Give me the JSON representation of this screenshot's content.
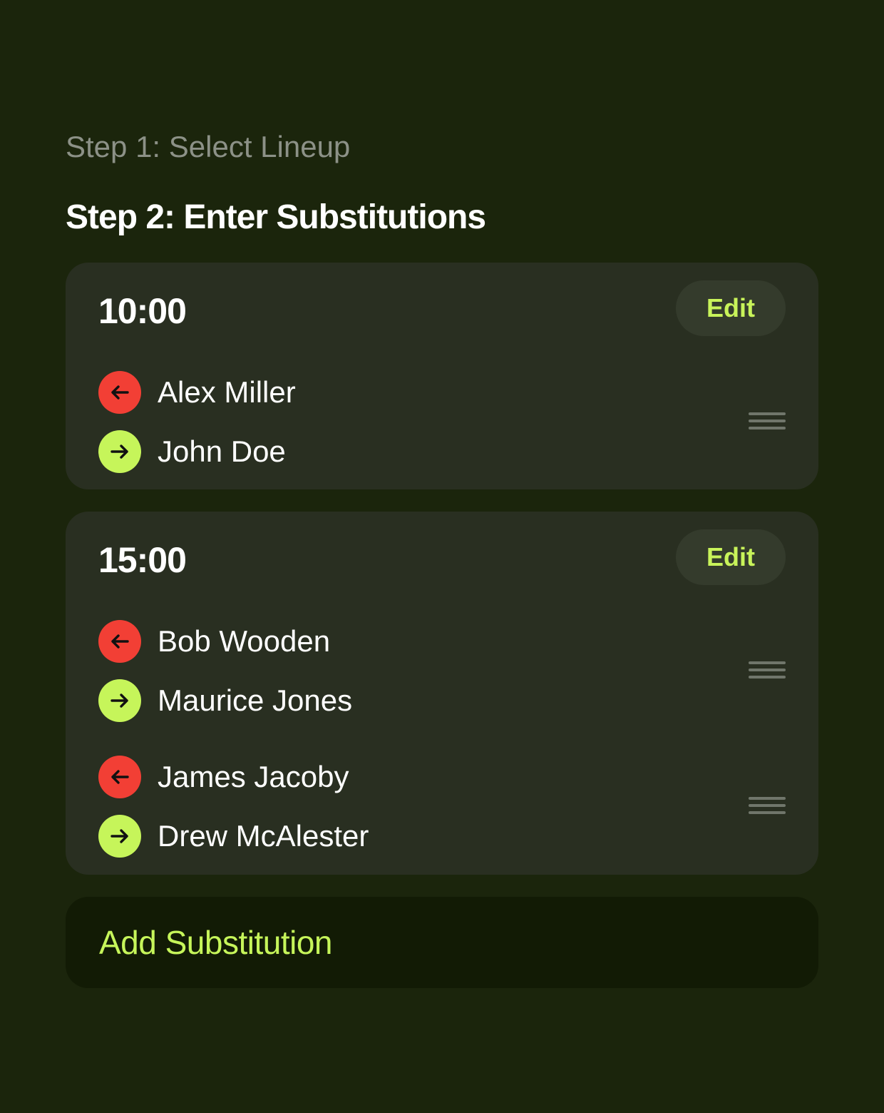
{
  "steps": {
    "step1_label": "Step 1: Select Lineup",
    "step2_label": "Step 2: Enter Substitutions"
  },
  "substitutions": [
    {
      "time": "10:00",
      "edit_label": "Edit",
      "swaps": [
        {
          "out_player": "Alex Miller",
          "in_player": "John Doe"
        }
      ]
    },
    {
      "time": "15:00",
      "edit_label": "Edit",
      "swaps": [
        {
          "out_player": "Bob Wooden",
          "in_player": "Maurice Jones"
        },
        {
          "out_player": "James Jacoby",
          "in_player": "Drew McAlester"
        }
      ]
    }
  ],
  "add_button": {
    "label": "Add Substitution"
  },
  "icons": {
    "out": "arrow-left-icon",
    "in": "arrow-right-icon",
    "handle": "drag-handle-icon"
  },
  "colors": {
    "background": "#1b250c",
    "card": "#292f21",
    "accent": "#c6f55a",
    "out_red": "#f23f35"
  }
}
